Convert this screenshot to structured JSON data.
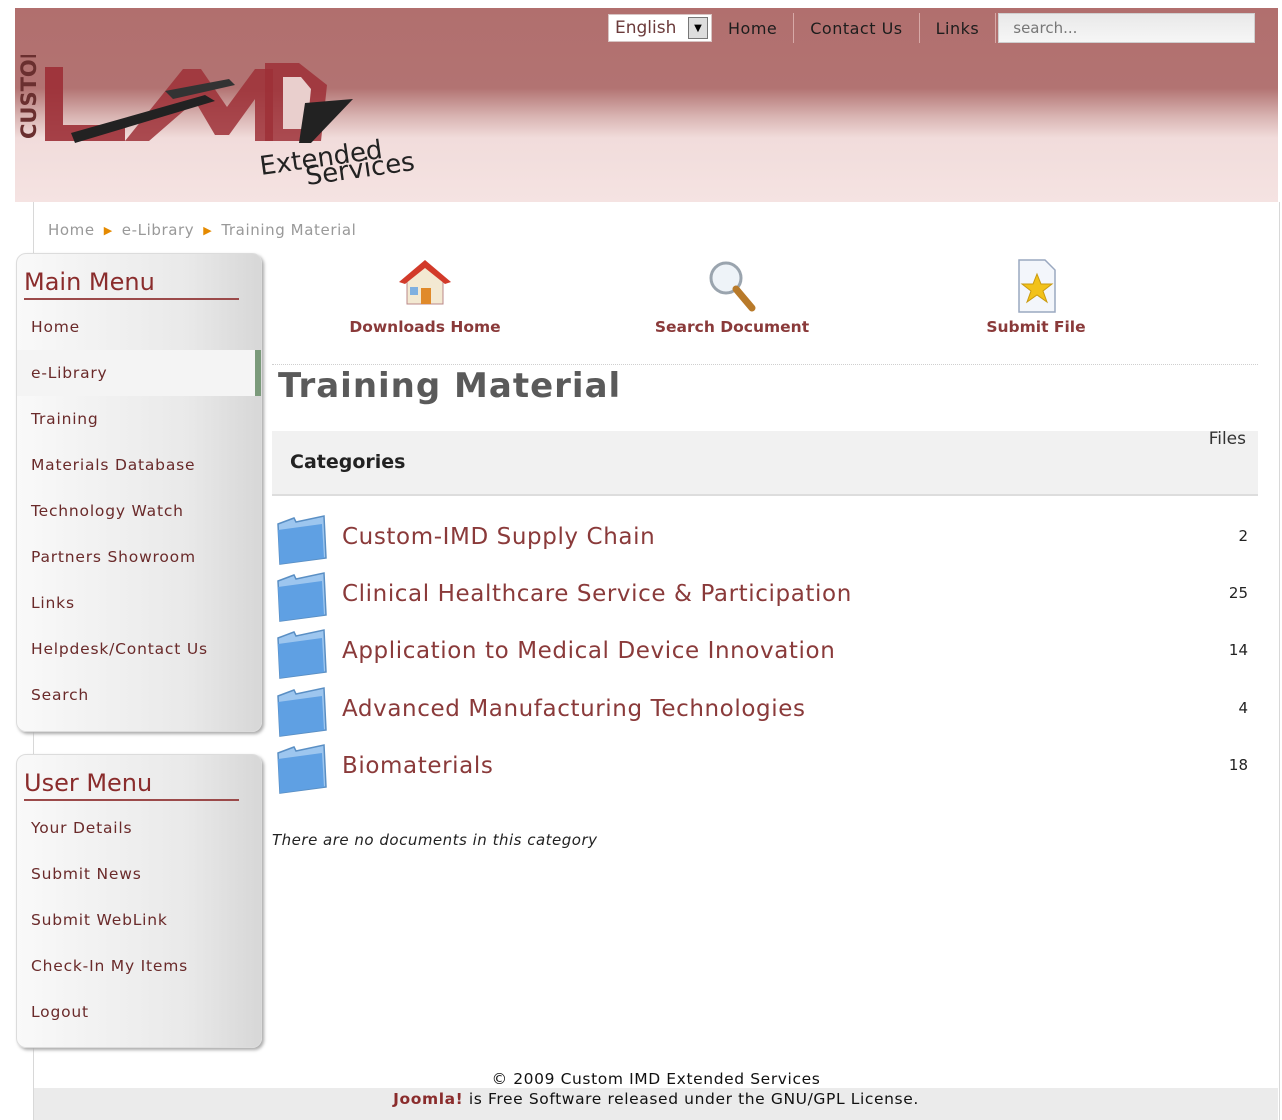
{
  "header": {
    "language": "English",
    "nav": [
      "Home",
      "Contact Us",
      "Links"
    ],
    "search_placeholder": "search...",
    "logo": {
      "vertical_text": "CUSTOM",
      "line1": "Extended",
      "line2": "Services"
    }
  },
  "breadcrumb": [
    "Home",
    "e-Library",
    "Training Material"
  ],
  "main_menu": {
    "title": "Main Menu",
    "items": [
      "Home",
      "e-Library",
      "Training",
      "Materials Database",
      "Technology Watch",
      "Partners Showroom",
      "Links",
      "Helpdesk/Contact Us",
      "Search"
    ],
    "active": "e-Library"
  },
  "user_menu": {
    "title": "User Menu",
    "items": [
      "Your Details",
      "Submit News",
      "Submit WebLink",
      "Check-In My Items",
      "Logout"
    ]
  },
  "toolbar": {
    "downloads_home": "Downloads Home",
    "search_document": "Search Document",
    "submit_file": "Submit File"
  },
  "page_title": "Training Material",
  "categories": {
    "header": "Categories",
    "files_header": "Files",
    "rows": [
      {
        "name": "Custom-IMD Supply Chain",
        "count": "2"
      },
      {
        "name": "Clinical Healthcare Service & Participation",
        "count": "25"
      },
      {
        "name": "Application to Medical Device Innovation",
        "count": "14"
      },
      {
        "name": "Advanced Manufacturing Technologies",
        "count": "4"
      },
      {
        "name": "Biomaterials",
        "count": "18"
      }
    ]
  },
  "no_documents": "There are no documents in this category",
  "footer": {
    "copyright": "© 2009 Custom IMD Extended Services",
    "joomla": "Joomla!",
    "license": " is Free Software released under the GNU/GPL License."
  },
  "colors": {
    "brand": "#8a2c2c",
    "header": "#b27372",
    "active_marker": "#7b9a7b"
  }
}
